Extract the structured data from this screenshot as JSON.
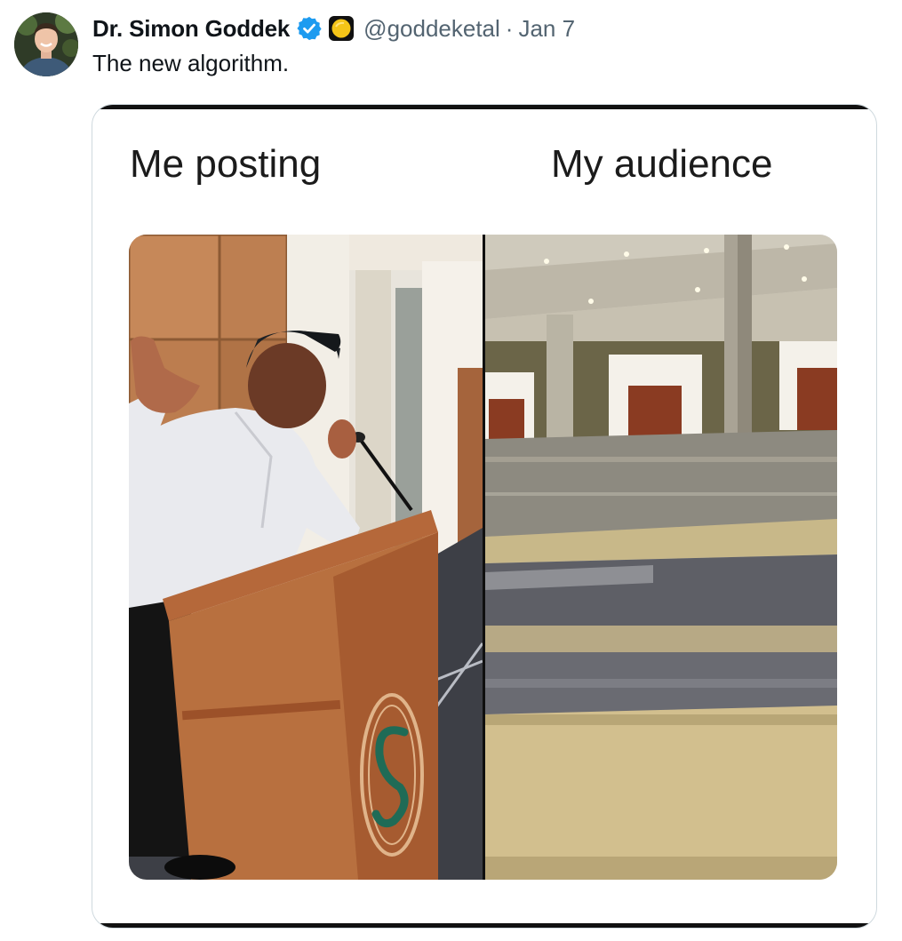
{
  "tweet": {
    "author_name": "Dr. Simon Goddek",
    "handle": "@goddeketal",
    "separator": "·",
    "timestamp": "Jan 7",
    "text": "The new algorithm.",
    "verified": true,
    "verified_color": "#1d9bf0",
    "affiliation_badge_color": "#f5c518"
  },
  "media": {
    "caption_left": "Me posting",
    "caption_right": "My audience"
  },
  "icons": {
    "avatar": "profile-photo",
    "verified": "verified-badge-icon",
    "affiliation": "affiliation-badge-icon"
  }
}
